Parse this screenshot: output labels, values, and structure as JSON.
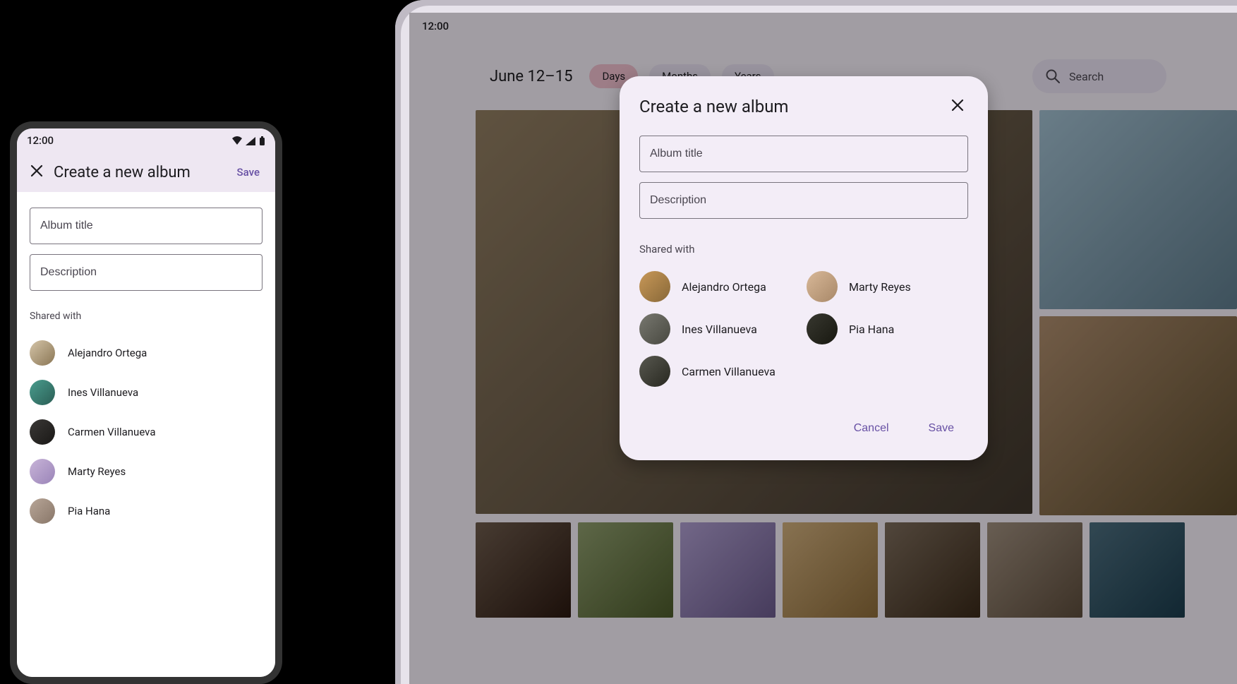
{
  "statusbar": {
    "time": "12:00"
  },
  "phone": {
    "header": {
      "title": "Create a new album",
      "save_label": "Save"
    },
    "title_placeholder": "Album title",
    "description_placeholder": "Description",
    "shared_with_label": "Shared with",
    "contacts": [
      {
        "name": "Alejandro Ortega",
        "avatar_class": "av-1"
      },
      {
        "name": "Ines Villanueva",
        "avatar_class": "av-2"
      },
      {
        "name": "Carmen Villanueva",
        "avatar_class": "av-3"
      },
      {
        "name": "Marty Reyes",
        "avatar_class": "av-4"
      },
      {
        "name": "Pia Hana",
        "avatar_class": "av-5"
      }
    ]
  },
  "tablet": {
    "date_range": "June 12–15",
    "tabs": {
      "days": "Days",
      "months": "Months",
      "years": "Years"
    },
    "search_placeholder": "Search",
    "dialog": {
      "title": "Create a new album",
      "title_placeholder": "Album title",
      "description_placeholder": "Description",
      "shared_with_label": "Shared with",
      "contacts": [
        {
          "name": "Alejandro Ortega",
          "avatar_class": "av-d1"
        },
        {
          "name": "Marty Reyes",
          "avatar_class": "av-d2"
        },
        {
          "name": "Ines Villanueva",
          "avatar_class": "av-d3"
        },
        {
          "name": "Pia Hana",
          "avatar_class": "av-d4"
        },
        {
          "name": "Carmen Villanueva",
          "avatar_class": "av-d5"
        }
      ],
      "cancel_label": "Cancel",
      "save_label": "Save"
    }
  }
}
